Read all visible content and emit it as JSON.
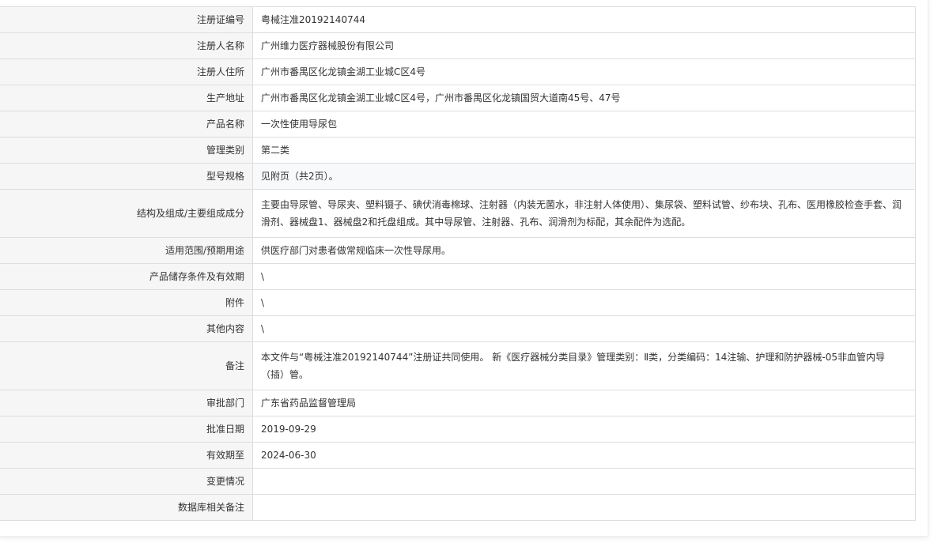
{
  "rows": [
    {
      "label": "注册证编号",
      "value": "粤械注准20192140744"
    },
    {
      "label": "注册人名称",
      "value": "广州维力医疗器械股份有限公司"
    },
    {
      "label": "注册人住所",
      "value": "广州市番禺区化龙镇金湖工业城C区4号"
    },
    {
      "label": "生产地址",
      "value": "广州市番禺区化龙镇金湖工业城C区4号，广州市番禺区化龙镇国贸大道南45号、47号"
    },
    {
      "label": "产品名称",
      "value": "一次性使用导尿包"
    },
    {
      "label": "管理类别",
      "value": "第二类"
    },
    {
      "label": "型号规格",
      "value": "见附页（共2页）。"
    },
    {
      "label": "结构及组成/主要组成成分",
      "value": "主要由导尿管、导尿夹、塑料镊子、碘伏消毒棉球、注射器（内装无菌水，非注射人体使用）、集尿袋、塑料试管、纱布块、孔布、医用橡胶检查手套、润滑剂、器械盘1、器械盘2和托盘组成。其中导尿管、注射器、孔布、润滑剂为标配，其余配件为选配。"
    },
    {
      "label": "适用范围/预期用途",
      "value": "供医疗部门对患者做常规临床一次性导尿用。"
    },
    {
      "label": "产品储存条件及有效期",
      "value": "\\"
    },
    {
      "label": "附件",
      "value": "\\"
    },
    {
      "label": "其他内容",
      "value": "\\"
    },
    {
      "label": "备注",
      "value": "本文件与“粤械注准20192140744”注册证共同使用。 新《医疗器械分类目录》管理类别：Ⅱ类，分类编码：14注输、护理和防护器械-05非血管内导（插）管。"
    },
    {
      "label": "审批部门",
      "value": "广东省药品监督管理局"
    },
    {
      "label": "批准日期",
      "value": "2019-09-29"
    },
    {
      "label": "有效期至",
      "value": "2024-06-30"
    },
    {
      "label": "变更情况",
      "value": ""
    },
    {
      "label": "数据库相关备注",
      "value": ""
    }
  ]
}
